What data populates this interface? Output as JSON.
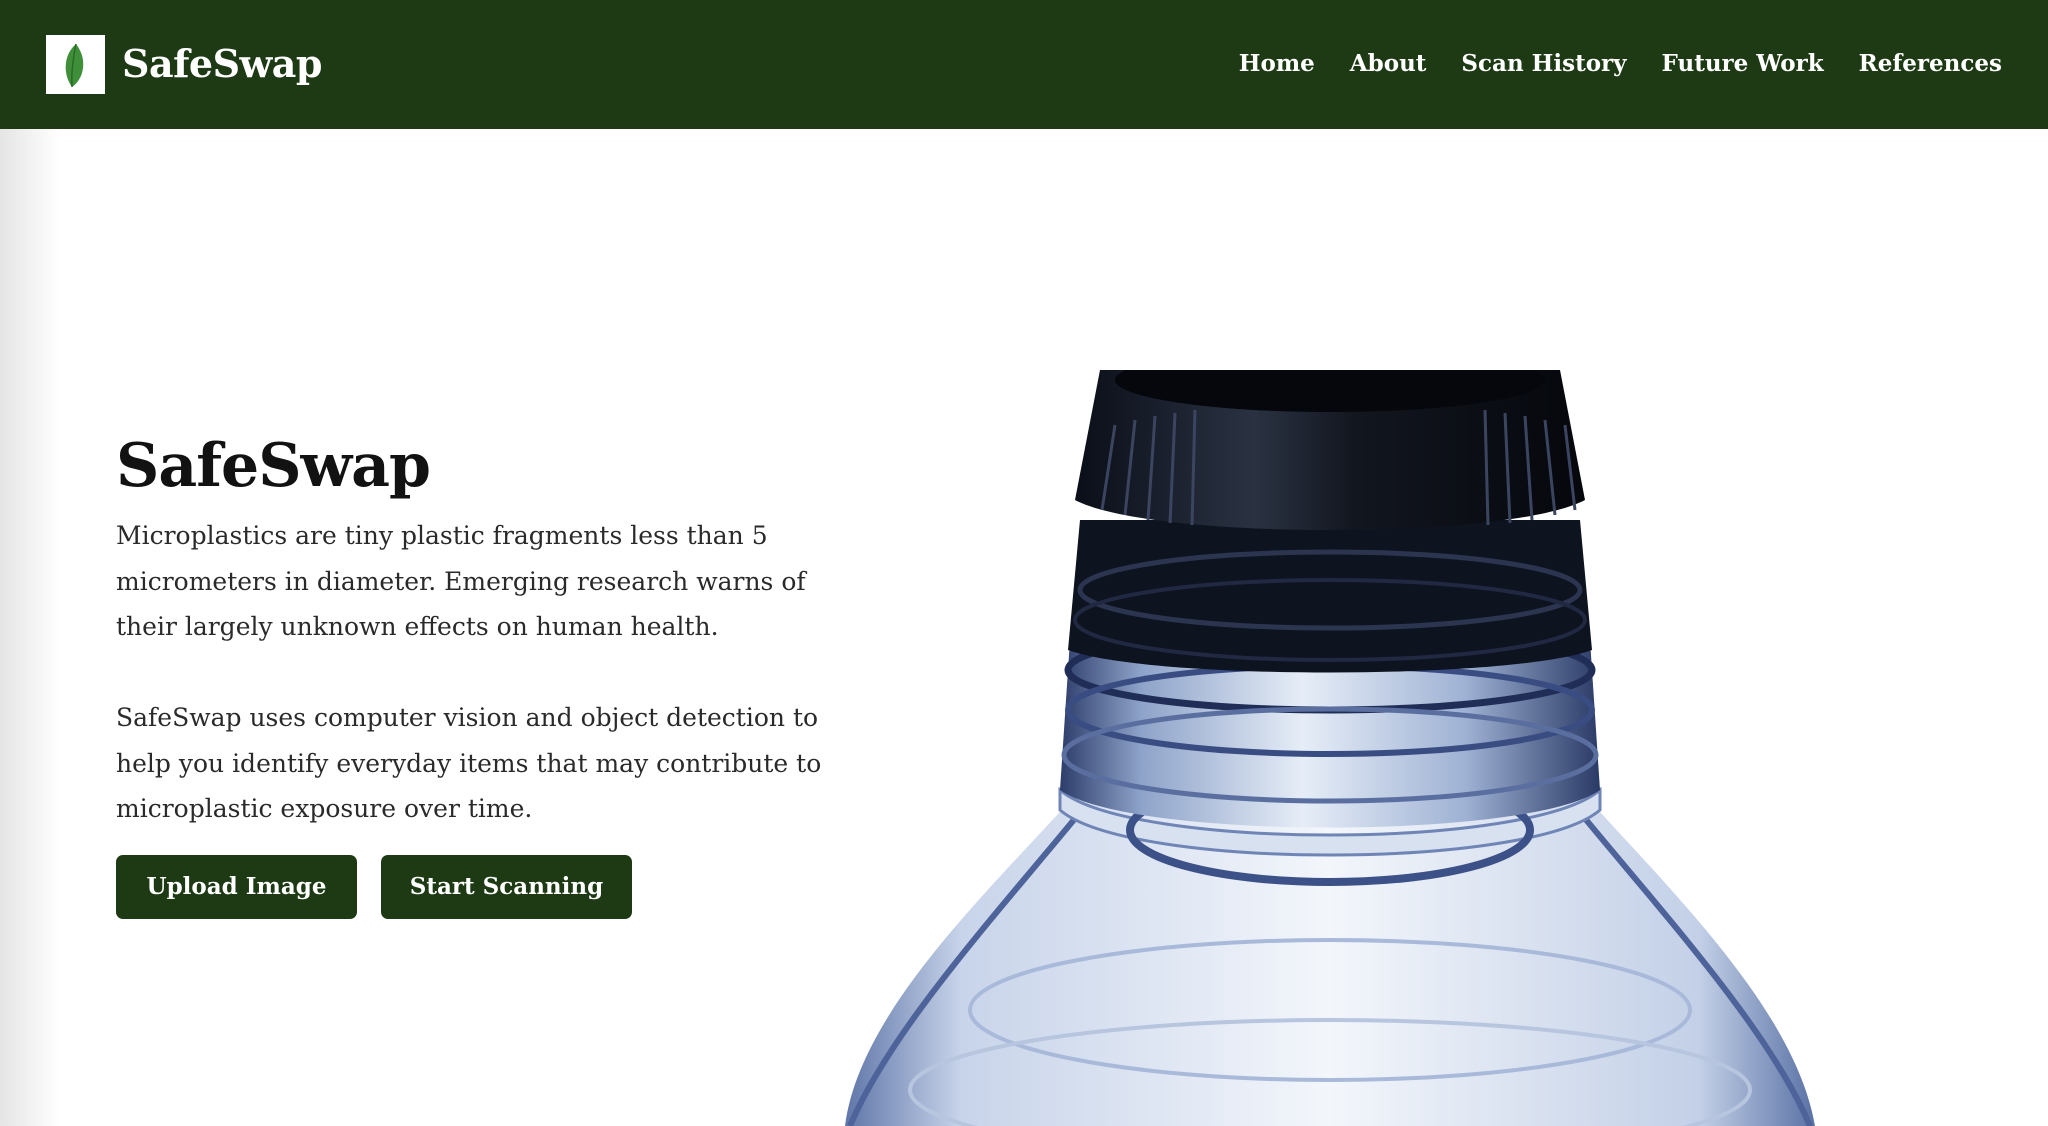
{
  "nav": {
    "logo_icon": "leaf-icon",
    "brand": "SafeSwap",
    "links": [
      "Home",
      "About",
      "Scan History",
      "Future Work",
      "References"
    ]
  },
  "hero": {
    "title": "SafeSwap",
    "paragraph_1": "Microplastics are tiny plastic fragments less than 5 micrometers in diameter. Emerging research warns of their largely unknown effects on human health.",
    "paragraph_2": "SafeSwap uses computer vision and object detection to help you identify everyday items that may contribute to microplastic exposure over time.",
    "buttons": {
      "upload": "Upload Image",
      "scan": "Start Scanning"
    },
    "image": "plastic-bottle-photo"
  },
  "colors": {
    "nav_background": "#1e3a14",
    "button_background": "#1e3a14",
    "leaf_green": "#3f8f3a",
    "text_dark": "#121212"
  }
}
